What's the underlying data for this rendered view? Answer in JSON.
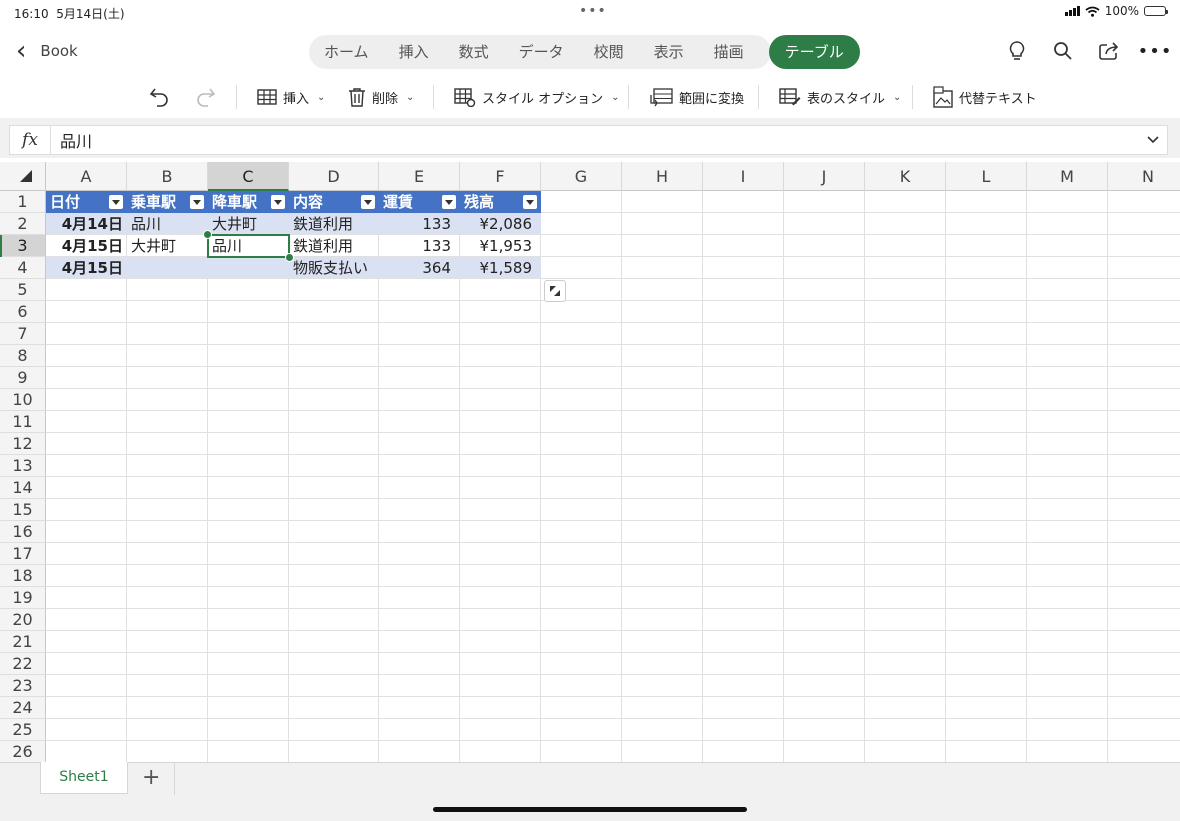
{
  "status": {
    "time": "16:10",
    "date": "5月14日(土)",
    "battery": "100%"
  },
  "nav": {
    "back_label": "Book"
  },
  "tabs": [
    "ホーム",
    "挿入",
    "数式",
    "データ",
    "校閲",
    "表示",
    "描画"
  ],
  "active_tab": "テーブル",
  "ribbon": {
    "insert": "挿入",
    "delete": "削除",
    "style_options": "スタイル オプション",
    "convert_range": "範囲に変換",
    "table_style": "表のスタイル",
    "alt_text": "代替テキスト"
  },
  "formula": {
    "fx": "fx",
    "value": "品川"
  },
  "columns": [
    "A",
    "B",
    "C",
    "D",
    "E",
    "F",
    "G",
    "H",
    "I",
    "J",
    "K",
    "L",
    "M",
    "N"
  ],
  "rows": [
    "1",
    "2",
    "3",
    "4",
    "5",
    "6",
    "7",
    "8",
    "9",
    "10",
    "11",
    "12",
    "13",
    "14",
    "15",
    "16",
    "17",
    "18",
    "19",
    "20",
    "21",
    "22",
    "23",
    "24",
    "25",
    "26"
  ],
  "selected_cell": "C3",
  "table": {
    "headers": [
      "日付",
      "乗車駅",
      "降車駅",
      "内容",
      "運賃",
      "残高"
    ],
    "rows": [
      [
        "4月14日",
        "品川",
        "大井町",
        "鉄道利用",
        "133",
        "¥2,086"
      ],
      [
        "4月15日",
        "大井町",
        "品川",
        "鉄道利用",
        "133",
        "¥1,953"
      ],
      [
        "4月15日",
        "",
        "",
        "物販支払い",
        "364",
        "¥1,589"
      ]
    ]
  },
  "sheets": {
    "active": "Sheet1",
    "add": "+"
  },
  "colors": {
    "accent": "#2e7d46",
    "table_header": "#4472c4",
    "table_band": "#d9e1f2"
  }
}
